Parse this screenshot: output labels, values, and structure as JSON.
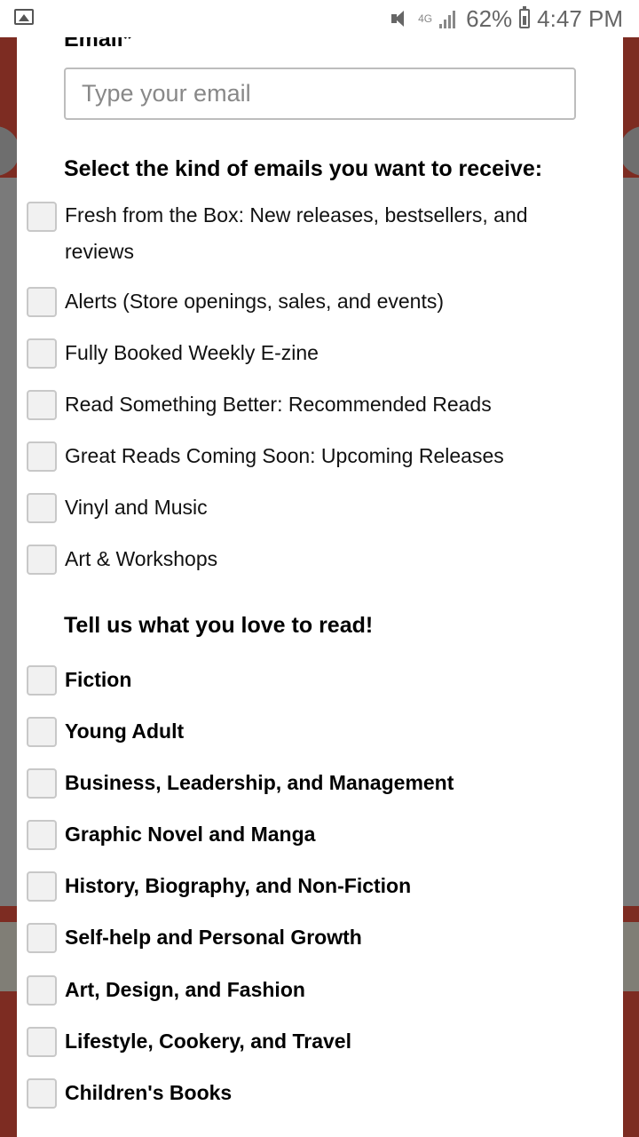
{
  "status_bar": {
    "network": "4G",
    "battery": "62%",
    "time": "4:47 PM",
    "icons": [
      "gallery-icon",
      "mute-icon",
      "signal-icon",
      "battery-icon"
    ]
  },
  "form": {
    "email_label": "Email*",
    "email_placeholder": "Type your email",
    "email_value": "",
    "emails_section_title": "Select the kind of emails you want to receive:",
    "email_types": [
      {
        "label": "Fresh from the Box: New releases, bestsellers, and reviews",
        "checked": false
      },
      {
        "label": "Alerts (Store openings, sales, and events)",
        "checked": false
      },
      {
        "label": "Fully Booked Weekly E-zine",
        "checked": false
      },
      {
        "label": "Read Something Better: Recommended Reads",
        "checked": false
      },
      {
        "label": "Great Reads Coming Soon: Upcoming Releases",
        "checked": false
      },
      {
        "label": "Vinyl and Music",
        "checked": false
      },
      {
        "label": "Art & Workshops",
        "checked": false
      }
    ],
    "genres_section_title": "Tell us what you love to read!",
    "genres": [
      {
        "label": "Fiction",
        "checked": false
      },
      {
        "label": "Young Adult",
        "checked": false
      },
      {
        "label": "Business, Leadership, and Management",
        "checked": false
      },
      {
        "label": "Graphic Novel and Manga",
        "checked": false
      },
      {
        "label": "History, Biography, and Non-Fiction",
        "checked": false
      },
      {
        "label": "Self-help and Personal Growth",
        "checked": false
      },
      {
        "label": "Art, Design, and Fashion",
        "checked": false
      },
      {
        "label": "Lifestyle, Cookery, and Travel",
        "checked": false
      },
      {
        "label": "Children's Books",
        "checked": false
      }
    ]
  },
  "colors": {
    "background_red": "#7d2c22",
    "overlay_gray": "#7a7a7a",
    "checkbox_border": "#c8c8c8"
  }
}
